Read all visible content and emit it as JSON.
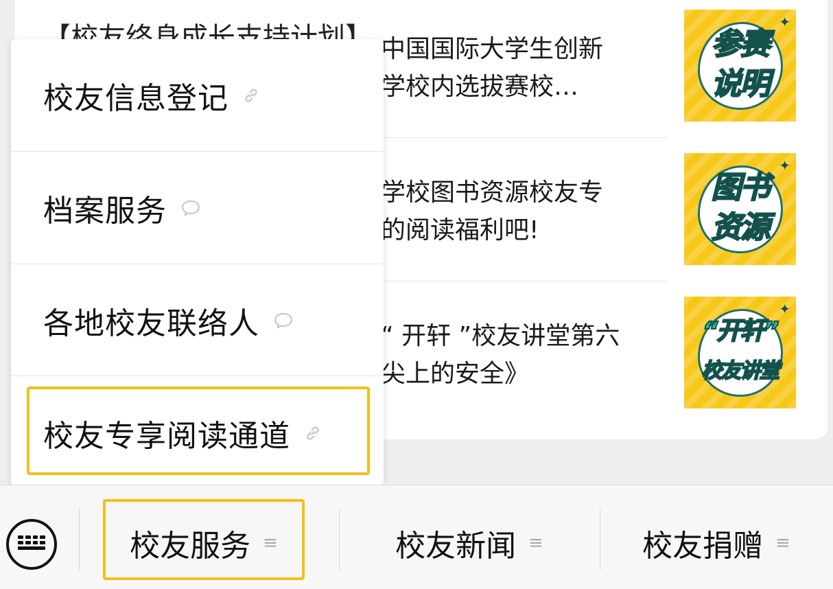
{
  "articles": [
    {
      "title": "中国国际大学生创新\n学校内选拔赛校…",
      "thumb": [
        "参赛",
        "说明"
      ]
    },
    {
      "title": "学校图书资源校友专\n的阅读福利吧!",
      "thumb": [
        "图书",
        "资源"
      ]
    },
    {
      "title": "“ 开轩 ”校友讲堂第六\n尖上的安全》",
      "thumb": [
        "“开轩”",
        "校友讲堂"
      ]
    }
  ],
  "top_clipped_text": "【校友终身成长支持计划】",
  "menu": {
    "items": [
      {
        "label": "校友信息登记",
        "icon": "link-icon"
      },
      {
        "label": "档案服务",
        "icon": "chat-bubble-icon"
      },
      {
        "label": "各地校友联络人",
        "icon": "chat-bubble-icon"
      },
      {
        "label": "校友专享阅读通道",
        "icon": "link-icon"
      }
    ]
  },
  "bottom_bar": {
    "keyboard_icon": "keyboard-icon",
    "tabs": [
      {
        "label": "校友服务",
        "icon": "menu-lines-icon"
      },
      {
        "label": "校友新闻",
        "icon": "menu-lines-icon"
      },
      {
        "label": "校友捐赠",
        "icon": "menu-lines-icon"
      }
    ]
  },
  "colors": {
    "highlight": "#f6be1a",
    "thumb_bg": "#f7c71a",
    "thumb_text": "#2fb7a8"
  }
}
